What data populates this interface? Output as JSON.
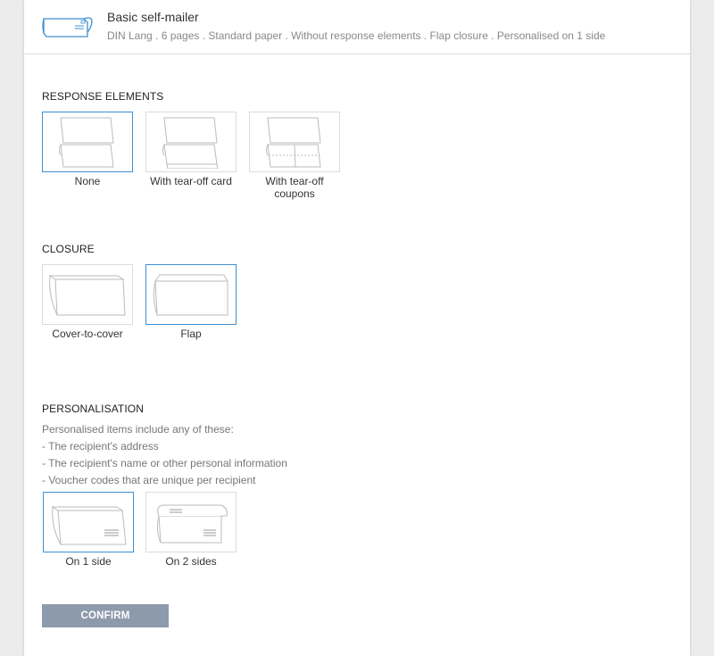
{
  "product": {
    "icon": "self-mailer-icon",
    "title": "Basic self-mailer",
    "description": "DIN Lang . 6 pages . Standard paper . Without response elements . Flap closure . Personalised on 1 side"
  },
  "response_elements": {
    "title": "RESPONSE ELEMENTS",
    "options": [
      {
        "label": "None",
        "icon": "no-response-element-icon",
        "selected": true
      },
      {
        "label": "With tear-off card",
        "icon": "tear-off-card-icon",
        "selected": false
      },
      {
        "label": "With tear-off coupons",
        "icon": "tear-off-coupons-icon",
        "selected": false
      }
    ]
  },
  "closure": {
    "title": "CLOSURE",
    "options": [
      {
        "label": "Cover-to-cover",
        "icon": "cover-to-cover-icon",
        "selected": false
      },
      {
        "label": "Flap",
        "icon": "flap-closure-icon",
        "selected": true
      }
    ]
  },
  "personalisation": {
    "title": "PERSONALISATION",
    "intro": "Personalised items include any of these:",
    "items": [
      "- The recipient's address",
      "- The recipient's name or other personal information",
      "- Voucher codes that are unique per recipient"
    ],
    "options": [
      {
        "label": "On 1 side",
        "icon": "personalised-one-side-icon",
        "selected": true
      },
      {
        "label": "On 2 sides",
        "icon": "personalised-two-sides-icon",
        "selected": false
      }
    ]
  },
  "confirm_label": "CONFIRM",
  "colors": {
    "selected_border": "#3f8fd2",
    "confirm_bg": "#8d9aab",
    "icon_stroke": "#bbbbbb"
  }
}
